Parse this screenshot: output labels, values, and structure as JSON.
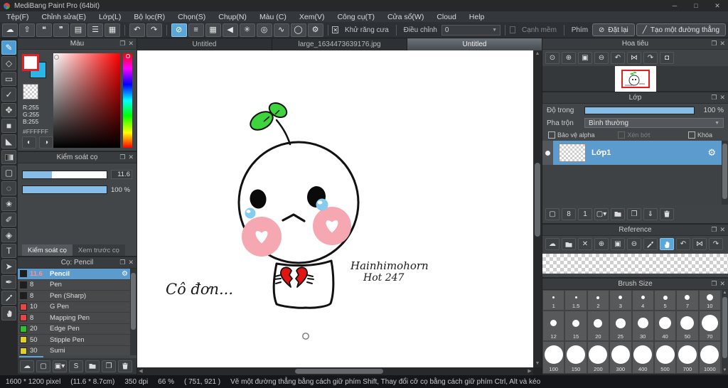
{
  "window": {
    "title": "MediBang Paint Pro (64bit)",
    "controls": [
      {
        "name": "minimize-button",
        "glyph": "─"
      },
      {
        "name": "maximize-button",
        "glyph": "□"
      },
      {
        "name": "close-button",
        "glyph": "✕"
      }
    ]
  },
  "menu": {
    "items": [
      "Tệp(F)",
      "Chỉnh sửa(E)",
      "Lớp(L)",
      "Bộ lọc(R)",
      "Chọn(S)",
      "Chụp(N)",
      "Màu (C)",
      "Xem(V)",
      "Công cụ(T)",
      "Cửa sổ(W)",
      "Cloud",
      "Help"
    ]
  },
  "toolbar": {
    "group1": [
      {
        "name": "cloud-icon",
        "glyph": "☁"
      },
      {
        "name": "export-icon",
        "glyph": "⇧"
      },
      {
        "name": "comment-icon",
        "glyph": "❝"
      },
      {
        "name": "comment-lines-icon",
        "glyph": "❞"
      },
      {
        "name": "document-icon",
        "glyph": "▤"
      },
      {
        "name": "material-list-icon",
        "glyph": "☰"
      },
      {
        "name": "material-grid-icon",
        "glyph": "▦"
      }
    ],
    "group2": [
      {
        "name": "undo-icon",
        "glyph": "↶"
      },
      {
        "name": "redo-icon",
        "glyph": "↷"
      }
    ],
    "group3": [
      {
        "name": "snap-off-icon",
        "glyph": "⊘",
        "active": true
      },
      {
        "name": "snap-parallel-icon",
        "glyph": "≡"
      },
      {
        "name": "snap-grid-icon",
        "glyph": "▦"
      },
      {
        "name": "snap-vanishing-icon",
        "glyph": "◀"
      },
      {
        "name": "snap-radial-icon",
        "glyph": "✳"
      },
      {
        "name": "snap-concentric-icon",
        "glyph": "◎"
      },
      {
        "name": "snap-curve-icon",
        "glyph": "∿"
      },
      {
        "name": "snap-ellipse-icon",
        "glyph": "◯"
      },
      {
        "name": "snap-settings-icon",
        "glyph": "⚙"
      }
    ],
    "antialias_label": "Khử răng cưa",
    "correction_label": "Điều chỉnh",
    "correction_value": "0",
    "soft_edge_label": "Cạnh mềm",
    "key_label": "Phím",
    "reset_button": "Đặt lại",
    "line_button": "Tạo một đường thẳng"
  },
  "tools": [
    {
      "name": "brush-tool",
      "glyph": "✎",
      "active": true
    },
    {
      "name": "eraser-tool",
      "glyph": "◇"
    },
    {
      "name": "rectangle-tool",
      "glyph": "▭"
    },
    {
      "name": "polyline-tool",
      "glyph": "✓"
    },
    {
      "name": "move-tool",
      "glyph": "✥"
    },
    {
      "name": "fill-rect-tool",
      "glyph": "■"
    },
    {
      "name": "bucket-tool",
      "glyph": "◣"
    },
    {
      "name": "gradient-tool",
      "glyph": "css:gradient"
    },
    {
      "name": "select-tool",
      "glyph": "▢"
    },
    {
      "name": "lasso-tool",
      "glyph": "◌"
    },
    {
      "name": "magic-wand-tool",
      "glyph": "✬"
    },
    {
      "name": "select-pen-tool",
      "glyph": "✐"
    },
    {
      "name": "select-eraser-tool",
      "glyph": "◈"
    },
    {
      "name": "text-tool",
      "glyph": "T"
    },
    {
      "name": "operation-tool",
      "glyph": "➤"
    },
    {
      "name": "pen-tool",
      "glyph": "✒"
    },
    {
      "name": "eyedropper-tool",
      "glyph": "svg:dropper"
    },
    {
      "name": "hand-tool",
      "glyph": "svg:hand"
    }
  ],
  "color_panel": {
    "title": "Màu",
    "r_label": "R:255",
    "g_label": "G:255",
    "b_label": "B:255",
    "hex_label": "#FFFFFF",
    "foreground_color": "#ffffff",
    "background_color": "#29b6e8",
    "buttons": [
      {
        "name": "palette-icon",
        "glyph": "◐"
      },
      {
        "name": "palette-edit-icon",
        "glyph": "◑"
      }
    ]
  },
  "brush_control": {
    "title": "Kiểm soát cọ",
    "size_value": "11.6",
    "size_fill_pct": 35,
    "opacity_value": "100 %",
    "opacity_fill_pct": 100,
    "tabs": [
      {
        "label": "Kiểm soát cọ",
        "active": true
      },
      {
        "label": "Xem trước cọ",
        "active": false
      }
    ]
  },
  "brush_list": {
    "title": "Cọ: Pencil",
    "items": [
      {
        "size": "11.6",
        "name": "Pencil",
        "swatch": "#1e1e1e",
        "selected": true
      },
      {
        "size": "8",
        "name": "Pen",
        "swatch": "#1e1e1e"
      },
      {
        "size": "8",
        "name": "Pen (Sharp)",
        "swatch": "#1e1e1e"
      },
      {
        "size": "10",
        "name": "G Pen",
        "swatch": "#e84545"
      },
      {
        "size": "8",
        "name": "Mapping Pen",
        "swatch": "#e84545"
      },
      {
        "size": "20",
        "name": "Edge Pen",
        "swatch": "#2ec22e"
      },
      {
        "size": "50",
        "name": "Stipple Pen",
        "swatch": "#e3cf2c"
      },
      {
        "size": "30",
        "name": "Sumi",
        "swatch": "#e3cf2c"
      }
    ],
    "toolbar": [
      {
        "name": "cloud-upload-icon",
        "glyph": "☁"
      },
      {
        "name": "add-brush-icon",
        "glyph": "▢"
      },
      {
        "name": "add-brush-image-icon",
        "glyph": "▣▾"
      },
      {
        "name": "add-script-brush-icon",
        "glyph": "S"
      },
      {
        "name": "folder-icon",
        "glyph": "svg:folder"
      },
      {
        "name": "duplicate-brush-icon",
        "glyph": "❐"
      },
      {
        "name": "delete-brush-icon",
        "glyph": "svg:trash"
      }
    ]
  },
  "navigator": {
    "title": "Hoa tiêu",
    "toolbar": [
      {
        "name": "zoom-reset-icon",
        "glyph": "⊙"
      },
      {
        "name": "zoom-in-icon",
        "glyph": "⊕"
      },
      {
        "name": "zoom-fit-icon",
        "glyph": "▣"
      },
      {
        "name": "zoom-out-icon",
        "glyph": "⊖"
      },
      {
        "name": "rotate-ccw-icon",
        "glyph": "↶"
      },
      {
        "name": "rotate-reset-icon",
        "glyph": "⋈"
      },
      {
        "name": "rotate-cw-icon",
        "glyph": "↷"
      },
      {
        "name": "lock-icon",
        "glyph": "◘"
      }
    ]
  },
  "layers": {
    "title": "Lớp",
    "opacity_label": "Độ trong",
    "opacity_value": "100 %",
    "blend_label": "Pha trộn",
    "blend_value": "Bình thường",
    "alpha_label": "Bảo vệ alpha",
    "clip_label": "Xén bớt",
    "lock_label": "Khóa",
    "layer_name": "Lớp1",
    "toolbar": [
      {
        "name": "new-layer-icon",
        "glyph": "▢"
      },
      {
        "name": "new-8bit-layer-icon",
        "glyph": "8"
      },
      {
        "name": "new-1bit-layer-icon",
        "glyph": "1"
      },
      {
        "name": "add-layer-menu-icon",
        "glyph": "▢▾"
      },
      {
        "name": "folder-icon",
        "glyph": "svg:folder"
      },
      {
        "name": "duplicate-layer-icon",
        "glyph": "❐"
      },
      {
        "name": "merge-down-icon",
        "glyph": "⇓"
      },
      {
        "name": "delete-layer-icon",
        "glyph": "svg:trash"
      }
    ]
  },
  "reference": {
    "title": "Reference",
    "toolbar": [
      {
        "name": "cloud-upload-icon",
        "glyph": "☁"
      },
      {
        "name": "open-folder-icon",
        "glyph": "svg:folder"
      },
      {
        "name": "clear-icon",
        "glyph": "✕"
      },
      {
        "name": "zoom-in-icon",
        "glyph": "⊕"
      },
      {
        "name": "zoom-fit-icon",
        "glyph": "▣"
      },
      {
        "name": "zoom-out-icon",
        "glyph": "⊖"
      },
      {
        "name": "eyedropper-icon",
        "glyph": "svg:dropper"
      },
      {
        "name": "hand-icon",
        "glyph": "svg:hand",
        "active": true
      },
      {
        "name": "rotate-ccw-icon",
        "glyph": "↶"
      },
      {
        "name": "rotate-reset-icon",
        "glyph": "⋈"
      },
      {
        "name": "rotate-cw-icon",
        "glyph": "↷"
      }
    ]
  },
  "brush_size": {
    "title": "Brush Size",
    "sizes": [
      "1",
      "1.5",
      "2",
      "3",
      "4",
      "5",
      "7",
      "10",
      "12",
      "15",
      "20",
      "25",
      "30",
      "40",
      "50",
      "70",
      "100",
      "150",
      "200",
      "300",
      "400",
      "500",
      "700",
      "1000"
    ]
  },
  "canvas": {
    "tabs": [
      {
        "label": "Untitled",
        "active": false
      },
      {
        "label": "large_1634473639176.jpg",
        "active": false
      },
      {
        "label": "Untitled",
        "active": true
      }
    ],
    "caption": "Cô đơn...",
    "signature1": "Hainhimohorn",
    "signature2": "Hot 247"
  },
  "status": {
    "segments": [
      "1600 * 1200 pixel",
      "(11.6 * 8.7cm)",
      "350 dpi",
      "66 %",
      "( 751, 921 )",
      "Vẽ một đường thẳng bằng cách giữ phím Shift, Thay đổi cỡ cọ bằng cách giữ phím Ctrl, Alt và kéo"
    ]
  }
}
